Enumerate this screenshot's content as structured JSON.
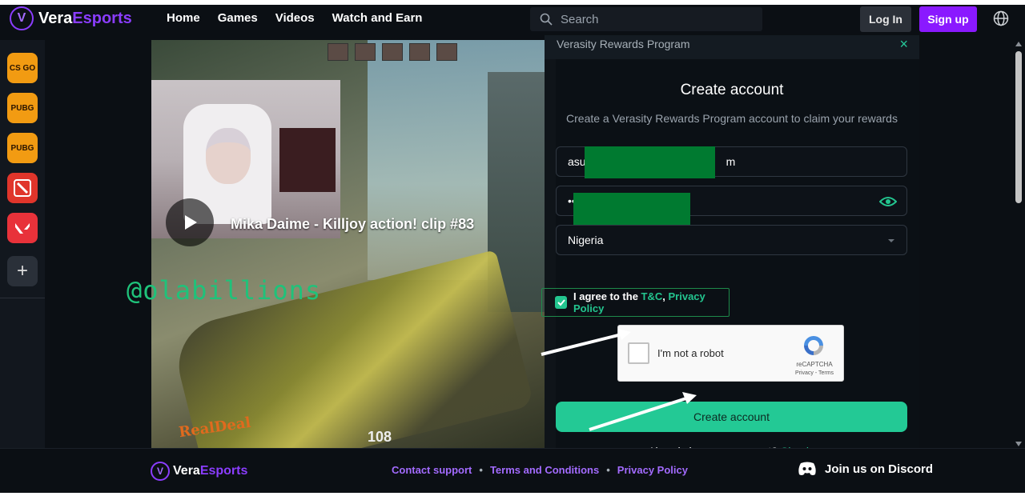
{
  "brand": {
    "name_left": "Vera",
    "name_right": "Esports",
    "mark": "V"
  },
  "nav": {
    "items": [
      {
        "label": "Home"
      },
      {
        "label": "Games"
      },
      {
        "label": "Videos"
      },
      {
        "label": "Watch and Earn"
      }
    ]
  },
  "search": {
    "placeholder": "Search"
  },
  "auth": {
    "login_label": "Log In",
    "signup_label": "Sign up"
  },
  "sidebar": {
    "games": [
      {
        "icon": "csgo-icon",
        "label": "CS GO",
        "color": "#f29b12"
      },
      {
        "icon": "pubg-icon",
        "label": "PUBG",
        "color": "#f29b12"
      },
      {
        "icon": "pubg-mobile-icon",
        "label": "PUBG",
        "color": "#f29b12"
      },
      {
        "icon": "dota-icon",
        "label": "",
        "color": "#e0352b"
      },
      {
        "icon": "valorant-icon",
        "label": "",
        "color": "#e8323a"
      }
    ],
    "add_label": "+"
  },
  "video": {
    "title": "Mika Daime - Killjoy action! clip #83",
    "watermark": "@olabillions",
    "ammo": "108",
    "overlay_brand": "RealDeal"
  },
  "panel": {
    "header_title": "Verasity Rewards Program",
    "close_label": "×",
    "title": "Create account",
    "subtitle": "Create a Verasity Rewards Program account to claim your rewards",
    "email_prefix": "asu",
    "email_suffix": "m",
    "password_value": "••",
    "country_value": "Nigeria",
    "agree_text": "I agree to the ",
    "tc_label": "T&C",
    "comma": ", ",
    "privacy_label": "Privacy Policy",
    "captcha_label": "I'm not a robot",
    "captcha_brand": "reCAPTCHA",
    "captcha_terms": "Privacy - Terms",
    "create_label": "Create account",
    "already_text": "Already have an account? ",
    "signin_label": "Sign in"
  },
  "footer": {
    "links": [
      {
        "label": "Contact support"
      },
      {
        "label": "Terms and Conditions"
      },
      {
        "label": "Privacy Policy"
      }
    ],
    "separator": "•",
    "discord_label": "Join us on Discord"
  },
  "colors": {
    "accent_purple": "#8a19ff",
    "accent_green": "#23c995",
    "background": "#0b0f14"
  }
}
